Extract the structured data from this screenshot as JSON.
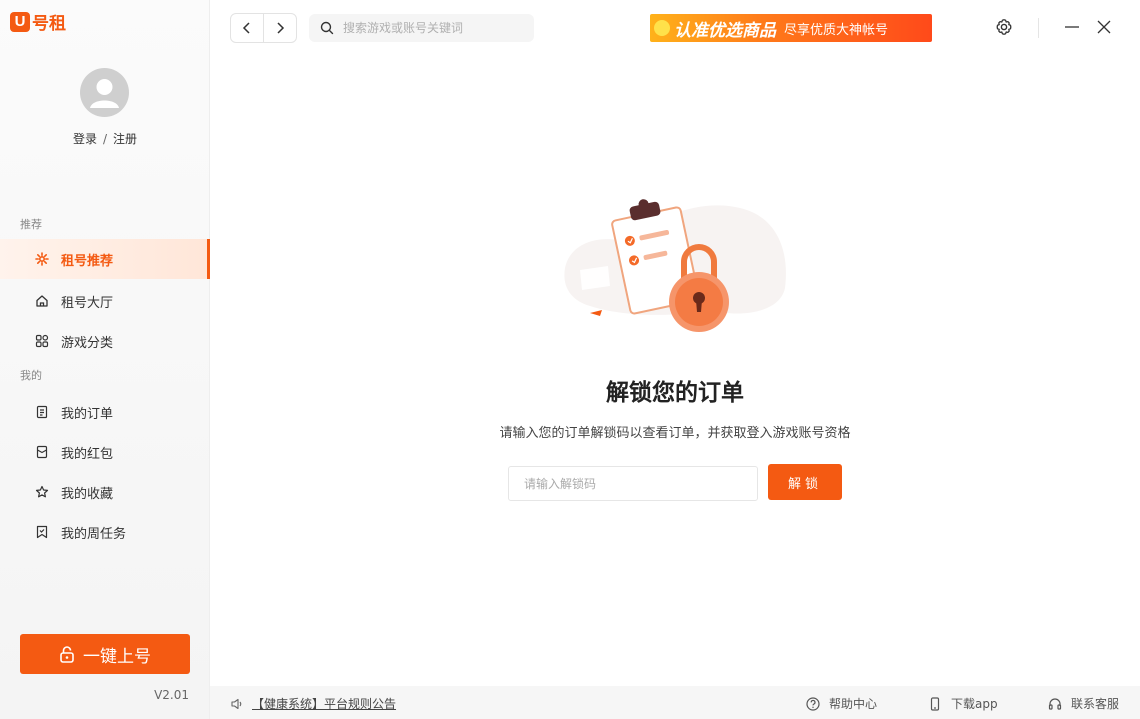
{
  "brand": {
    "logo_mark": "U",
    "logo_text": "号租",
    "accent_color": "#f45a12"
  },
  "user": {
    "login": "登录",
    "separator": "/",
    "register": "注册"
  },
  "sidebar": {
    "section_recommend": "推荐",
    "section_mine": "我的",
    "items": [
      {
        "label": "租号推荐",
        "icon": "gear-flower-icon",
        "active": true
      },
      {
        "label": "租号大厅",
        "icon": "home-icon"
      },
      {
        "label": "游戏分类",
        "icon": "grid-icon"
      },
      {
        "label": "我的订单",
        "icon": "document-icon"
      },
      {
        "label": "我的红包",
        "icon": "red-packet-icon"
      },
      {
        "label": "我的收藏",
        "icon": "star-icon"
      },
      {
        "label": "我的周任务",
        "icon": "task-flag-icon"
      }
    ],
    "oneclick_label": "一键上号",
    "version": "V2.01"
  },
  "topbar": {
    "search_placeholder": "搜索游戏或账号关键词",
    "banner_main": "认准优选商品",
    "banner_sub": "尽享优质大神帐号"
  },
  "main": {
    "title": "解锁您的订单",
    "subtitle": "请输入您的订单解锁码以查看订单，并获取登入游戏账号资格",
    "code_placeholder": "请输入解锁码",
    "code_value": "",
    "unlock_label": "解锁"
  },
  "footer": {
    "notice": "【健康系统】平台规则公告",
    "help": "帮助中心",
    "download": "下载app",
    "service": "联系客服"
  }
}
